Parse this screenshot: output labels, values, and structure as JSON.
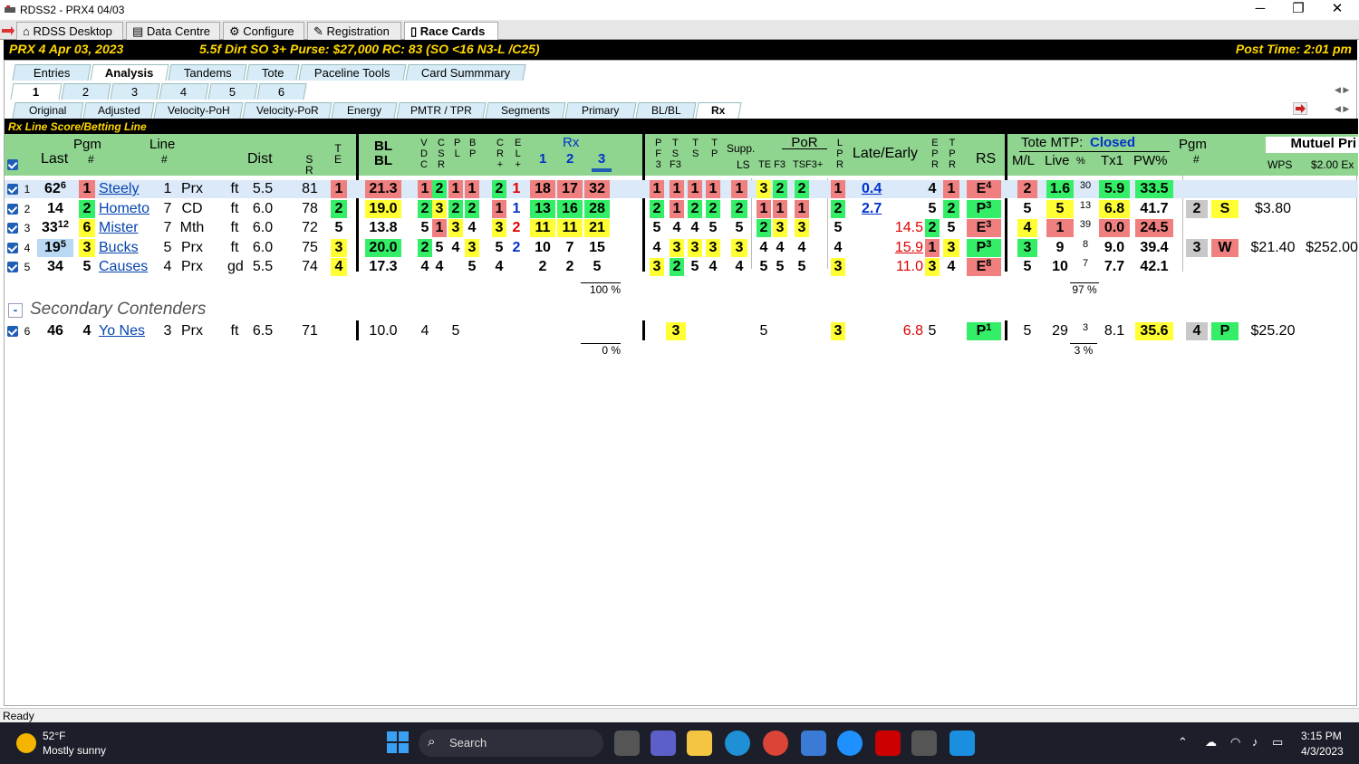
{
  "window": {
    "title": "RDSS2 - PRX4  04/03",
    "min": "─",
    "max": "❐",
    "close": "✕"
  },
  "doc_tabs": [
    "RDSS Desktop",
    "Data Centre",
    "Configure",
    "Registration",
    "Race Cards"
  ],
  "race_bar": {
    "race": "PRX  4  Apr 03, 2023",
    "conditions": "5.5f  Dirt   SO  3+   Purse: $27,000   RC: 83  (SO <16 N3-L /C25)",
    "post_time": "Post Time: 2:01 pm"
  },
  "view_tabs": [
    "Entries",
    "Analysis",
    "Tandems",
    "Tote",
    "Paceline Tools",
    "Card Summmary"
  ],
  "race_tabs": [
    "1",
    "2",
    "3",
    "4",
    "5",
    "6"
  ],
  "sub_tabs": [
    "Original",
    "Adjusted",
    "Velocity-PoH",
    "Velocity-PoR",
    "Energy",
    "PMTR / TPR",
    "Segments",
    "Primary",
    "BL/BL",
    "Rx"
  ],
  "section_title": "Rx Line Score/Betting Line",
  "headers": {
    "pgm": "Pgm",
    "pgm_hash": "#",
    "last": "Last",
    "line": "Line",
    "line_hash": "#",
    "dist": "Dist",
    "sr": "S\nR",
    "te": "T\nE",
    "blbl": "BL\nBL",
    "vdc": "V\nD\nC",
    "csr": "C\nS\nR",
    "pl": "P\nL",
    "bp": "B\nP",
    "cr": "C\nR\n+",
    "el": "E\nL\n+",
    "rx": "Rx",
    "rx1": "1",
    "rx2": "2",
    "rx3": "3",
    "pf3": "P\nF\n3",
    "tsf3": "T\nS\nF3",
    "ts": "T\nS",
    "tp": "T\nP",
    "supp": "Supp.",
    "ls": "LS",
    "por": "PoR",
    "te_f3": "TE F3",
    "tsf3p": "TSF3+",
    "lpr": "L\nP\nR",
    "late_early": "Late/Early",
    "epr": "E\nP\nR",
    "tpr": "T\nP\nR",
    "rs": "RS",
    "tote_mtp": "Tote MTP:",
    "tote_status": "Closed",
    "ml": "M/L",
    "live": "Live",
    "pct": "%",
    "tx1": "Tx1",
    "pw": "PW%",
    "pgm2": "Pgm",
    "mutuel": "Mutuel Pri",
    "wps": "WPS",
    "ex": "$2.00 Ex"
  },
  "rows": [
    {
      "n": "1",
      "last": "62",
      "last_sup": "6",
      "pgm": "1",
      "name": "Steely",
      "line": "1",
      "trk": "Prx",
      "sfc": "ft",
      "dist": "5.5",
      "sr": "81",
      "te": "1",
      "bl": "21.3",
      "vdc": "1",
      "csr": "2",
      "pl": "1",
      "bp": "1",
      "cr": "2",
      "el": "1",
      "rx1": "18",
      "rx2": "17",
      "rx3": "32",
      "pf3": "1",
      "tsf3": "1",
      "ts": "1",
      "tp": "1",
      "ls": "1",
      "te_a": "3",
      "te_b": "2",
      "tsf3p": "2",
      "lpr": "1",
      "le": "0.4",
      "epr": "4",
      "tpr": "1",
      "rs": "E",
      "rs_sup": "4",
      "ml": "2",
      "live": "1.6",
      "pc": "30",
      "tx1": "5.9",
      "pw": "33.5",
      "pgm2": "",
      "pos": "",
      "wps": "",
      "ex": ""
    },
    {
      "n": "2",
      "last": "14",
      "last_sup": "",
      "pgm": "2",
      "name": "Hometo",
      "line": "7",
      "trk": "CD",
      "sfc": "ft",
      "dist": "6.0",
      "sr": "78",
      "te": "2",
      "bl": "19.0",
      "vdc": "2",
      "csr": "3",
      "pl": "2",
      "bp": "2",
      "cr": "1",
      "el": "1",
      "rx1": "13",
      "rx2": "16",
      "rx3": "28",
      "pf3": "2",
      "tsf3": "1",
      "ts": "2",
      "tp": "2",
      "ls": "2",
      "te_a": "1",
      "te_b": "1",
      "tsf3p": "1",
      "lpr": "2",
      "le": "2.7",
      "epr": "5",
      "tpr": "2",
      "rs": "P",
      "rs_sup": "3",
      "ml": "5",
      "live": "5",
      "pc": "13",
      "tx1": "6.8",
      "pw": "41.7",
      "pgm2": "2",
      "pos": "S",
      "wps": "$3.80",
      "ex": ""
    },
    {
      "n": "3",
      "last": "33",
      "last_sup": "12",
      "pgm": "6",
      "name": "Mister",
      "line": "7",
      "trk": "Mth",
      "sfc": "ft",
      "dist": "6.0",
      "sr": "72",
      "te": "5",
      "bl": "13.8",
      "vdc": "5",
      "csr": "1",
      "pl": "3",
      "bp": "4",
      "cr": "3",
      "el": "2",
      "rx1": "11",
      "rx2": "11",
      "rx3": "21",
      "pf3": "5",
      "tsf3": "4",
      "ts": "4",
      "tp": "5",
      "ls": "5",
      "te_a": "2",
      "te_b": "3",
      "tsf3p": "3",
      "lpr": "5",
      "le": "14.5",
      "epr": "2",
      "tpr": "5",
      "rs": "E",
      "rs_sup": "3",
      "ml": "4",
      "live": "1",
      "pc": "39",
      "tx1": "0.0",
      "pw": "24.5",
      "pgm2": "",
      "pos": "",
      "wps": "",
      "ex": ""
    },
    {
      "n": "4",
      "last": "19",
      "last_sup": "5",
      "pgm": "3",
      "name": "Bucks",
      "line": "5",
      "trk": "Prx",
      "sfc": "ft",
      "dist": "6.0",
      "sr": "75",
      "te": "3",
      "bl": "20.0",
      "vdc": "2",
      "csr": "5",
      "pl": "4",
      "bp": "3",
      "cr": "5",
      "el": "2",
      "rx1": "10",
      "rx2": "7",
      "rx3": "15",
      "pf3": "4",
      "tsf3": "3",
      "ts": "3",
      "tp": "3",
      "ls": "3",
      "te_a": "4",
      "te_b": "4",
      "tsf3p": "4",
      "lpr": "4",
      "le": "15.9",
      "epr": "1",
      "tpr": "3",
      "rs": "P",
      "rs_sup": "3",
      "ml": "3",
      "live": "9",
      "pc": "8",
      "tx1": "9.0",
      "pw": "39.4",
      "pgm2": "3",
      "pos": "W",
      "wps": "$21.40",
      "ex": "$252.00"
    },
    {
      "n": "5",
      "last": "34",
      "last_sup": "",
      "pgm": "5",
      "name": "Causes",
      "line": "4",
      "trk": "Prx",
      "sfc": "gd",
      "dist": "5.5",
      "sr": "74",
      "te": "4",
      "bl": "17.3",
      "vdc": "4",
      "csr": "4",
      "pl": "",
      "bp": "5",
      "cr": "4",
      "el": "",
      "rx1": "2",
      "rx2": "2",
      "rx3": "5",
      "pf3": "3",
      "tsf3": "2",
      "ts": "5",
      "tp": "4",
      "ls": "4",
      "te_a": "5",
      "te_b": "5",
      "tsf3p": "5",
      "lpr": "3",
      "le": "11.0",
      "epr": "3",
      "tpr": "4",
      "rs": "E",
      "rs_sup": "8",
      "ml": "5",
      "live": "10",
      "pc": "7",
      "tx1": "7.7",
      "pw": "42.1",
      "pgm2": "",
      "pos": "",
      "wps": "",
      "ex": ""
    }
  ],
  "pct_main_rx": "100 %",
  "pct_main_tote": "97 %",
  "secondary_label": "Secondary Contenders",
  "secondary_toggle": "-",
  "secondary_row": {
    "n": "6",
    "last": "46",
    "pgm": "4",
    "name": "Yo Nes",
    "line": "3",
    "trk": "Prx",
    "sfc": "ft",
    "dist": "6.5",
    "sr": "71",
    "bl": "10.0",
    "vdc": "4",
    "csr": "5",
    "pf3": "3",
    "ls": "5",
    "lpr": "3",
    "le": "6.8",
    "epr": "5",
    "rs": "P",
    "rs_sup": "1",
    "ml": "5",
    "live": "29",
    "pc": "3",
    "tx1": "8.1",
    "pw": "35.6",
    "pgm2": "4",
    "pos": "P",
    "wps": "$25.20"
  },
  "pct_sec_rx": "0 %",
  "pct_sec_tote": "3 %",
  "status": "Ready",
  "taskbar": {
    "temp": "52°F",
    "weather": "Mostly sunny",
    "search": "Search",
    "time": "3:15 PM",
    "date": "4/3/2023"
  }
}
